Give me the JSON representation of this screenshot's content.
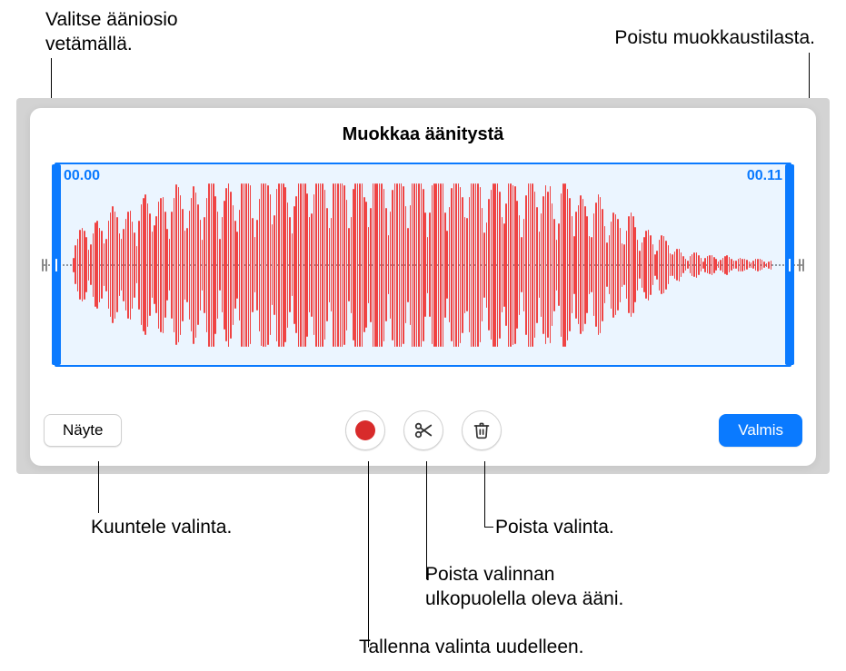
{
  "callouts": {
    "drag_select": "Valitse ääniosio\nvetämällä.",
    "exit_edit": "Poistu muokkaustilasta.",
    "listen_sel": "Kuuntele valinta.",
    "delete_sel": "Poista valinta.",
    "trim_outside": "Poista valinnan\nulkopuolella oleva ääni.",
    "rerecord": "Tallenna valinta uudelleen."
  },
  "panel": {
    "title": "Muokkaa äänitystä",
    "time_start": "00.00",
    "time_end": "00.11",
    "sample_button": "Näyte",
    "done_button": "Valmis"
  },
  "icons": {
    "record": "record-icon",
    "scissors": "scissors-icon",
    "trash": "trash-icon"
  }
}
